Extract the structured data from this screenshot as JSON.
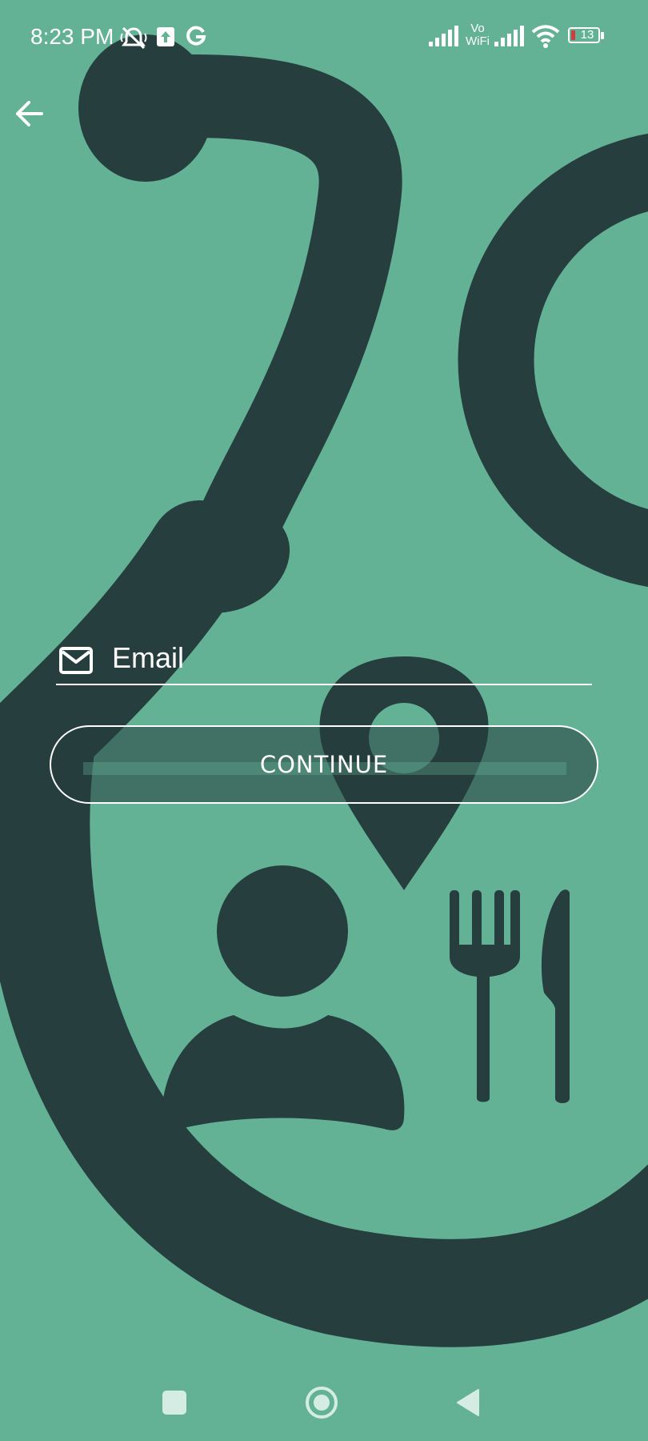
{
  "status_bar": {
    "time": "8:23 PM",
    "battery_level": "13",
    "network_label": "Vo WiFi",
    "icons": [
      "mute-alarm-icon",
      "upload-icon",
      "google-icon",
      "signal-icon",
      "vowifi-icon",
      "signal-icon",
      "wifi-icon",
      "battery-icon"
    ]
  },
  "header": {
    "back_icon": "arrow-left-icon"
  },
  "form": {
    "email": {
      "icon": "mail-icon",
      "placeholder": "Email",
      "value": ""
    },
    "continue_label": "CONTINUE"
  },
  "background": {
    "icons": [
      "stethoscope-icon",
      "location-pin-icon",
      "person-icon",
      "fork-icon",
      "knife-icon"
    ]
  },
  "nav_bar": {
    "icons": [
      "recent-apps-icon",
      "home-icon",
      "back-triangle-icon"
    ]
  },
  "colors": {
    "background": "#63b296",
    "art": "#263e3e",
    "foreground": "#ffffff"
  }
}
